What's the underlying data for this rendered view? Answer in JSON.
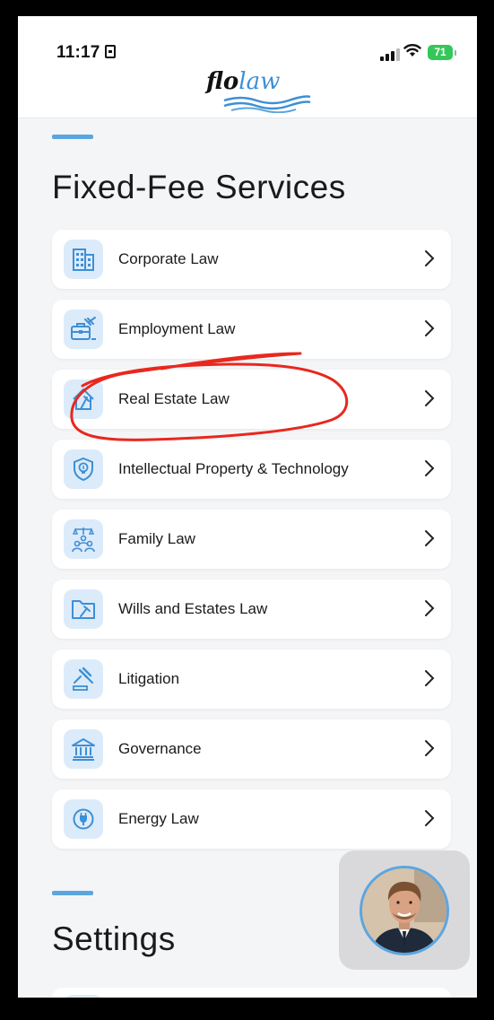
{
  "status_bar": {
    "time": "11:17",
    "battery": "71"
  },
  "header": {
    "logo_text_bold": "flo",
    "logo_text_accent": "law"
  },
  "sections": {
    "fixed_fee": {
      "title": "Fixed-Fee Services"
    },
    "settings": {
      "title": "Settings"
    }
  },
  "services": [
    {
      "label": "Corporate Law",
      "icon": "building-icon"
    },
    {
      "label": "Employment Law",
      "icon": "briefcase-gavel-icon"
    },
    {
      "label": "Real Estate Law",
      "icon": "house-icon"
    },
    {
      "label": "Intellectual Property & Technology",
      "icon": "shield-bulb-icon"
    },
    {
      "label": "Family Law",
      "icon": "family-scales-icon"
    },
    {
      "label": "Wills and Estates Law",
      "icon": "folder-gavel-icon"
    },
    {
      "label": "Litigation",
      "icon": "gavel-icon"
    },
    {
      "label": "Governance",
      "icon": "institution-icon"
    },
    {
      "label": "Energy Law",
      "icon": "power-plug-icon"
    }
  ],
  "colors": {
    "accent": "#5ba6e0",
    "icon_bg": "#dcebfa",
    "annotation": "#e8281e",
    "battery": "#34c759"
  }
}
